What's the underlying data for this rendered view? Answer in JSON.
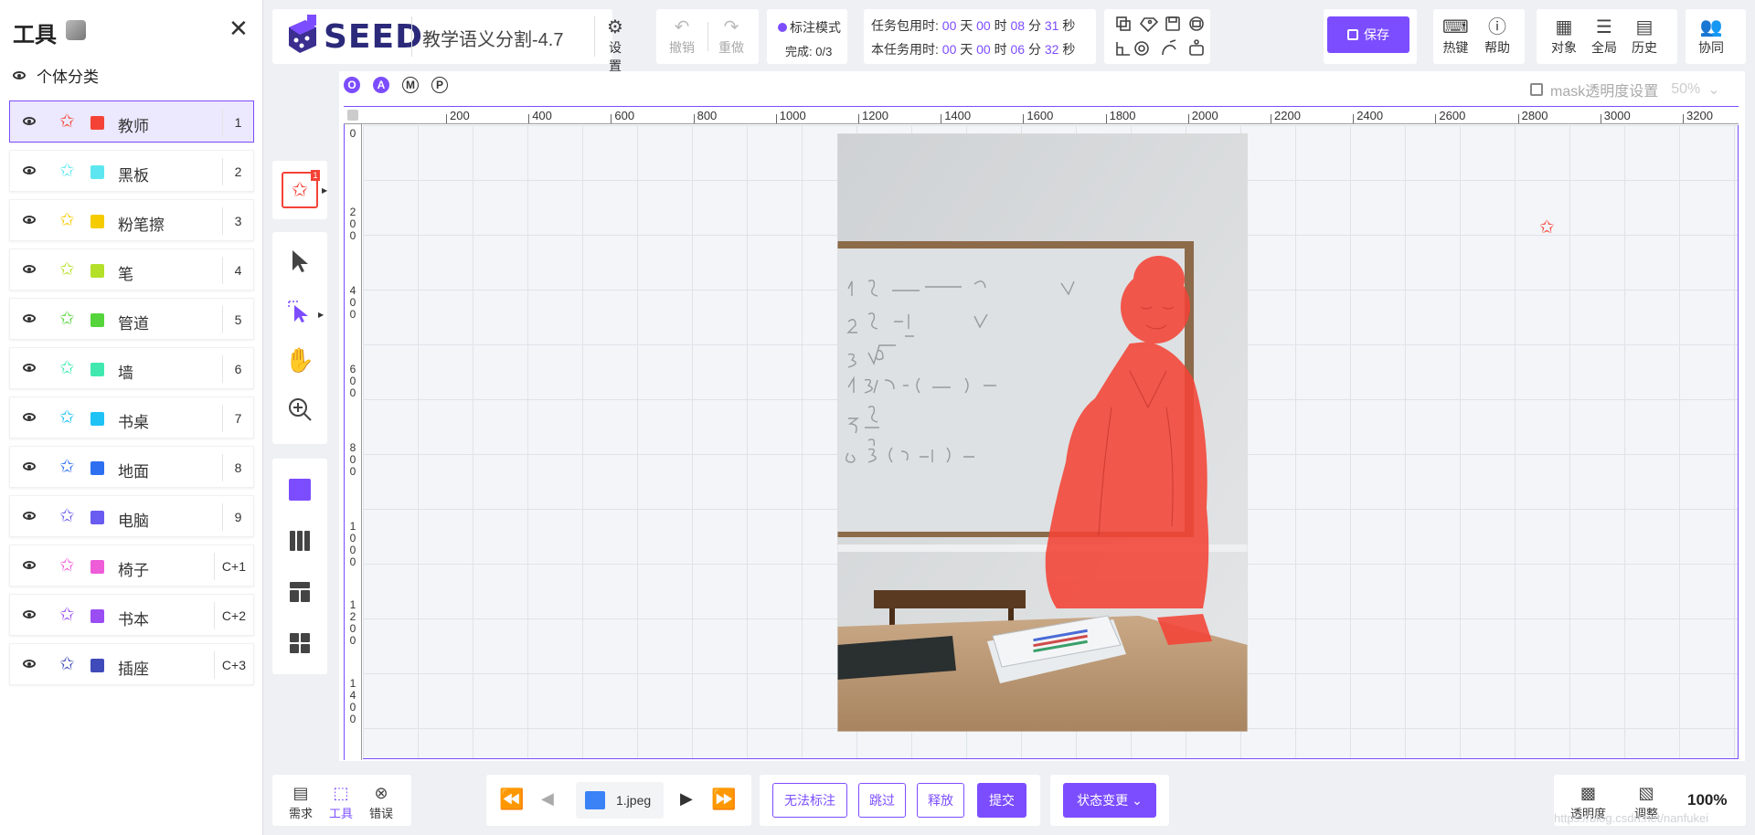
{
  "sidebar": {
    "title": "工具",
    "group_label": "个体分类",
    "classes": [
      {
        "name": "教师",
        "key": "1",
        "color": "#f44336",
        "active": true
      },
      {
        "name": "黑板",
        "key": "2",
        "color": "#5ee6f0"
      },
      {
        "name": "粉笔擦",
        "key": "3",
        "color": "#f5cc00"
      },
      {
        "name": "笔",
        "key": "4",
        "color": "#b5e02a"
      },
      {
        "name": "管道",
        "key": "5",
        "color": "#55d43b"
      },
      {
        "name": "墙",
        "key": "6",
        "color": "#40e8b0"
      },
      {
        "name": "书桌",
        "key": "7",
        "color": "#1fc2f5"
      },
      {
        "name": "地面",
        "key": "8",
        "color": "#2d6ff0"
      },
      {
        "name": "电脑",
        "key": "9",
        "color": "#6a5cf0"
      },
      {
        "name": "椅子",
        "key": "C+1",
        "color": "#ee5cd8"
      },
      {
        "name": "书本",
        "key": "C+2",
        "color": "#9a4df2"
      },
      {
        "name": "插座",
        "key": "C+3",
        "color": "#3f4bb8"
      }
    ]
  },
  "header": {
    "logo_text": "SEED",
    "project_title": "教学语义分割-4.7",
    "settings_label": "设置",
    "undo_label": "撤销",
    "redo_label": "重做",
    "mode_label": "标注模式",
    "progress_label": "完成: 0/3",
    "timer1_label": "任务包用时:",
    "timer1": {
      "days": "00",
      "hours": "00",
      "minutes": "08",
      "seconds": "31"
    },
    "timer2_label": "本任务用时:",
    "timer2": {
      "days": "00",
      "hours": "00",
      "minutes": "06",
      "seconds": "32"
    },
    "unit_day": "天",
    "unit_hour": "时",
    "unit_minute": "分",
    "unit_second": "秒",
    "save_label": "保存",
    "hotkey_label": "热键",
    "help_label": "帮助",
    "object_label": "对象",
    "global_label": "全局",
    "history_label": "历史",
    "collab_label": "协同"
  },
  "canvas": {
    "mode_badges": [
      "O",
      "A",
      "M",
      "P"
    ],
    "mask_label": "mask透明度设置",
    "mask_value": "50%",
    "ruler_top": [
      "200",
      "400",
      "600",
      "800",
      "1000",
      "1200",
      "1400",
      "1600",
      "1800",
      "2000",
      "2200",
      "2400",
      "2600",
      "2800",
      "3000",
      "3200"
    ],
    "ruler_left": [
      "0",
      "200",
      "400",
      "600",
      "800",
      "1000",
      "1200",
      "1400"
    ],
    "tool_badge": "1"
  },
  "footer": {
    "req_label": "需求",
    "tool_label": "工具",
    "error_label": "错误",
    "file_name": "1.jpeg",
    "unable_label": "无法标注",
    "skip_label": "跳过",
    "release_label": "释放",
    "submit_label": "提交",
    "status_label": "状态变更",
    "opacity_label": "透明度",
    "adjust_label": "调整",
    "zoom": "100%",
    "watermark": "https://blog.csdn.net/nanfukei"
  },
  "colors": {
    "accent": "#7c4dff",
    "mask": "#f44336"
  }
}
